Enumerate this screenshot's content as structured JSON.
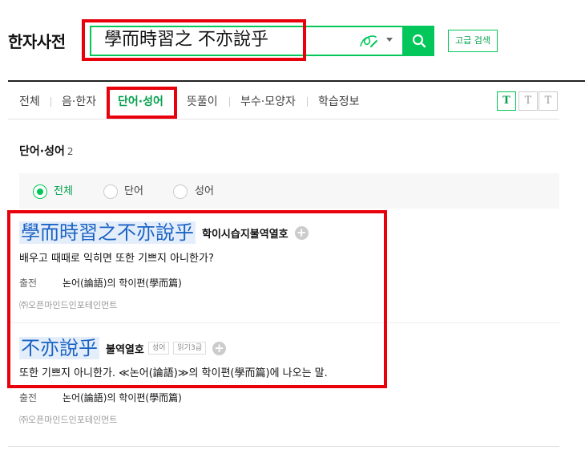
{
  "app": {
    "title": "한자사전"
  },
  "search": {
    "query": "學而時習之 不亦說乎",
    "advanced_label": "고급 검색"
  },
  "tabs": [
    {
      "label": "전체"
    },
    {
      "label": "음·한자"
    },
    {
      "label": "단어·성어",
      "active": true
    },
    {
      "label": "뜻풀이"
    },
    {
      "label": "부수·모양자"
    },
    {
      "label": "학습정보"
    }
  ],
  "font_size_buttons": [
    "T",
    "T",
    "T"
  ],
  "section": {
    "title": "단어·성어",
    "count": "2"
  },
  "filters": [
    {
      "label": "전체",
      "selected": true
    },
    {
      "label": "단어",
      "selected": false
    },
    {
      "label": "성어",
      "selected": false
    }
  ],
  "entries": [
    {
      "hanja": "學而時習之不亦說乎",
      "reading": "학이시습지불역열호",
      "meaning": "배우고 때때로 익히면 또한 기쁘지 아니한가?",
      "source_label": "출전",
      "source": "논어(論語)의 학이편(學而篇)",
      "provider": "㈜오픈마인드인포테인먼트"
    },
    {
      "hanja": "不亦說乎",
      "reading": "불역열호",
      "tags": [
        "성어",
        "읽기3급"
      ],
      "meaning": "또한 기쁘지 아니한가. ≪논어(論語)≫의 학이편(學而篇)에 나오는 말.",
      "source_label": "출전",
      "source": "논어(論語)의 학이편(學而篇)",
      "provider": "㈜오픈마인드인포테인먼트"
    }
  ],
  "colors": {
    "brand": "#03c75a",
    "highlight": "#e8000b",
    "hanja": "#1b63c4"
  }
}
